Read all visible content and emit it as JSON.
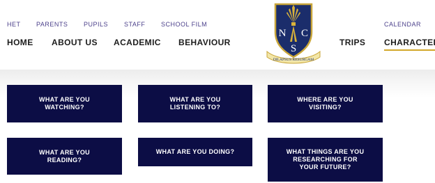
{
  "utility_nav": [
    {
      "label": "HET"
    },
    {
      "label": "PARENTS"
    },
    {
      "label": "PUPILS"
    },
    {
      "label": "STAFF"
    },
    {
      "label": "SCHOOL FILM"
    }
  ],
  "utility_right": {
    "label": "CALENDAR"
  },
  "main_nav": [
    {
      "label": "HOME"
    },
    {
      "label": "ABOUT US"
    },
    {
      "label": "ACADEMIC"
    },
    {
      "label": "BEHAVIOUR"
    },
    {
      "label": "TRIPS"
    },
    {
      "label": "CHARACTER"
    }
  ],
  "logo": {
    "letters": [
      "N",
      "C",
      "S"
    ],
    "motto": "DILAPSUS RESURGAM"
  },
  "tiles": [
    {
      "label": "WHAT ARE YOU\nWATCHING?"
    },
    {
      "label": "WHAT ARE YOU\nLISTENING TO?"
    },
    {
      "label": "WHERE ARE YOU\nVISITING?"
    },
    {
      "label": "WHAT ARE YOU\nREADING?"
    },
    {
      "label": "WHAT ARE YOU DOING?"
    },
    {
      "label": "WHAT THINGS ARE YOU\nRESEARCHING FOR\nYOUR FUTURE?"
    }
  ],
  "colors": {
    "tile_bg": "#0c0d45",
    "accent": "#d2a72a",
    "utility_text": "#4a3f8a"
  }
}
